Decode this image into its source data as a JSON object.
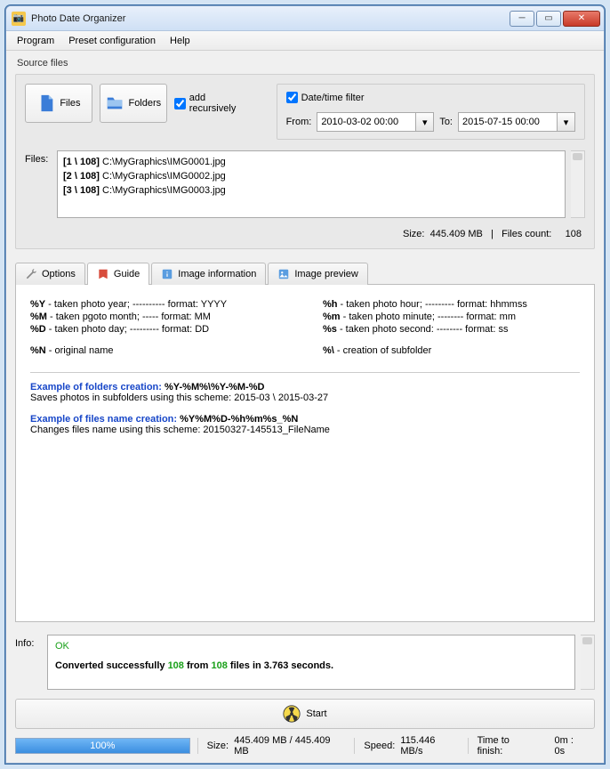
{
  "window": {
    "title": "Photo Date Organizer"
  },
  "menu": {
    "program": "Program",
    "preset": "Preset configuration",
    "help": "Help"
  },
  "source": {
    "label": "Source files",
    "files_btn": "Files",
    "folders_btn": "Folders",
    "recursive_label": "add recursively",
    "files_field_label": "Files:",
    "list": [
      {
        "counter": "[1 \\ 108]",
        "path": "C:\\MyGraphics\\IMG0001.jpg"
      },
      {
        "counter": "[2 \\ 108]",
        "path": "C:\\MyGraphics\\IMG0002.jpg"
      },
      {
        "counter": "[3 \\ 108]",
        "path": "C:\\MyGraphics\\IMG0003.jpg"
      }
    ],
    "size_label": "Size:",
    "size_value": "445.409 MB",
    "count_label": "Files count:",
    "count_value": "108"
  },
  "filter": {
    "checkbox_label": "Date/time filter",
    "from_label": "From:",
    "from_value": "2010-03-02 00:00",
    "to_label": "To:",
    "to_value": "2015-07-15 00:00"
  },
  "tabs": {
    "options": "Options",
    "guide": "Guide",
    "image_info": "Image information",
    "image_preview": "Image preview"
  },
  "guide": {
    "y": "%Y",
    "y_desc": " - taken photo year; ---------- format: YYYY",
    "m_up": "%M",
    "m_up_desc": " - taken pgoto month; ----- format: MM",
    "d": "%D",
    "d_desc": " - taken photo day; --------- format: DD",
    "n": "%N",
    "n_desc": " - original name",
    "h": "%h",
    "h_desc": " - taken photo hour; --------- format: hhmmss",
    "m_low": "%m",
    "m_low_desc": " - taken photo minute; -------- format: mm",
    "s": "%s",
    "s_desc": " - taken photo second: -------- format: ss",
    "slash": "%\\",
    "slash_desc": " - creation of subfolder",
    "ex1_title": "Example of folders creation: ",
    "ex1_pattern": "%Y-%M%\\%Y-%M-%D",
    "ex1_desc": "Saves photos in subfolders using this scheme: 2015-03 \\ 2015-03-27",
    "ex2_title": "Example of files name creation: ",
    "ex2_pattern": "%Y%M%D-%h%m%s_%N",
    "ex2_desc": "Changes files name using this scheme: 20150327-145513_FileName"
  },
  "info": {
    "label": "Info:",
    "ok": "OK",
    "msg_1": "Converted successfully ",
    "msg_n1": "108",
    "msg_2": " from ",
    "msg_n2": "108",
    "msg_3": " files in 3.763 seconds."
  },
  "start": {
    "label": "Start"
  },
  "status": {
    "pct": "100%",
    "size_label": "Size:",
    "size_val": "445.409 MB  /  445.409 MB",
    "speed_label": "Speed:",
    "speed_val": "115.446 MB/s",
    "time_label": "Time to finish:",
    "time_val": "0m : 0s"
  }
}
